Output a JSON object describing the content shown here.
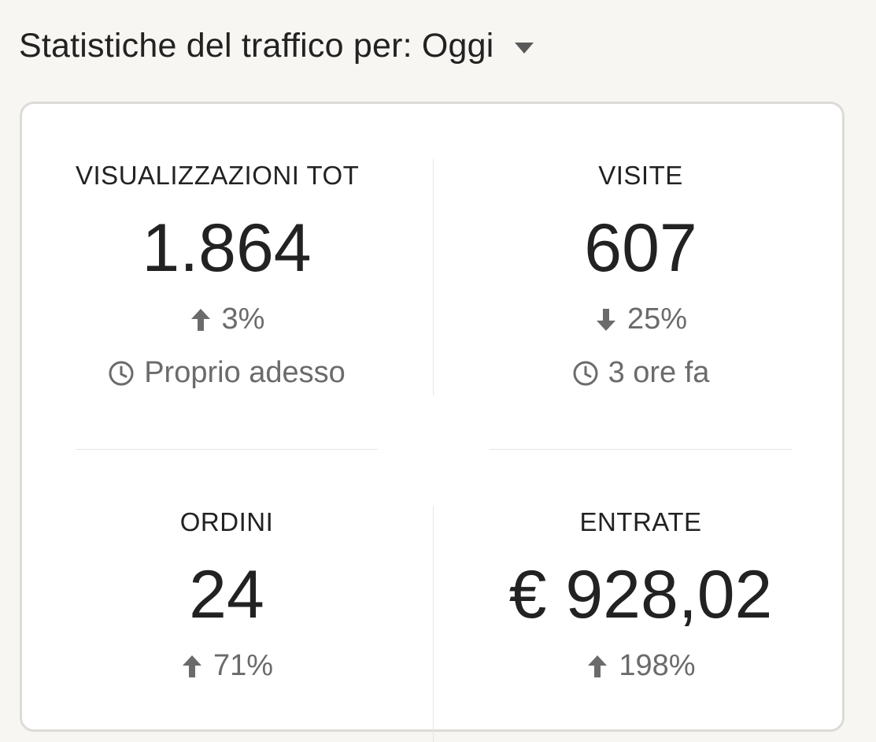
{
  "header": {
    "title": "Statistiche del traffico per: Oggi",
    "dropdown_icon": "caret-down-icon"
  },
  "stats": {
    "views": {
      "label": "VISUALIZZAZIONI TOT",
      "value": "1.864",
      "change": "3%",
      "change_direction": "up",
      "updated": "Proprio adesso"
    },
    "visits": {
      "label": "VISITE",
      "value": "607",
      "change": "25%",
      "change_direction": "down",
      "updated": "3 ore fa"
    },
    "orders": {
      "label": "ORDINI",
      "value": "24",
      "change": "71%",
      "change_direction": "up"
    },
    "revenue": {
      "label": "ENTRATE",
      "value": "€ 928,02",
      "change": "198%",
      "change_direction": "up"
    }
  },
  "colors": {
    "background": "#f7f6f2",
    "card": "#ffffff",
    "text": "#222222",
    "muted": "#6b6b6b",
    "border": "#dcdbd6"
  }
}
